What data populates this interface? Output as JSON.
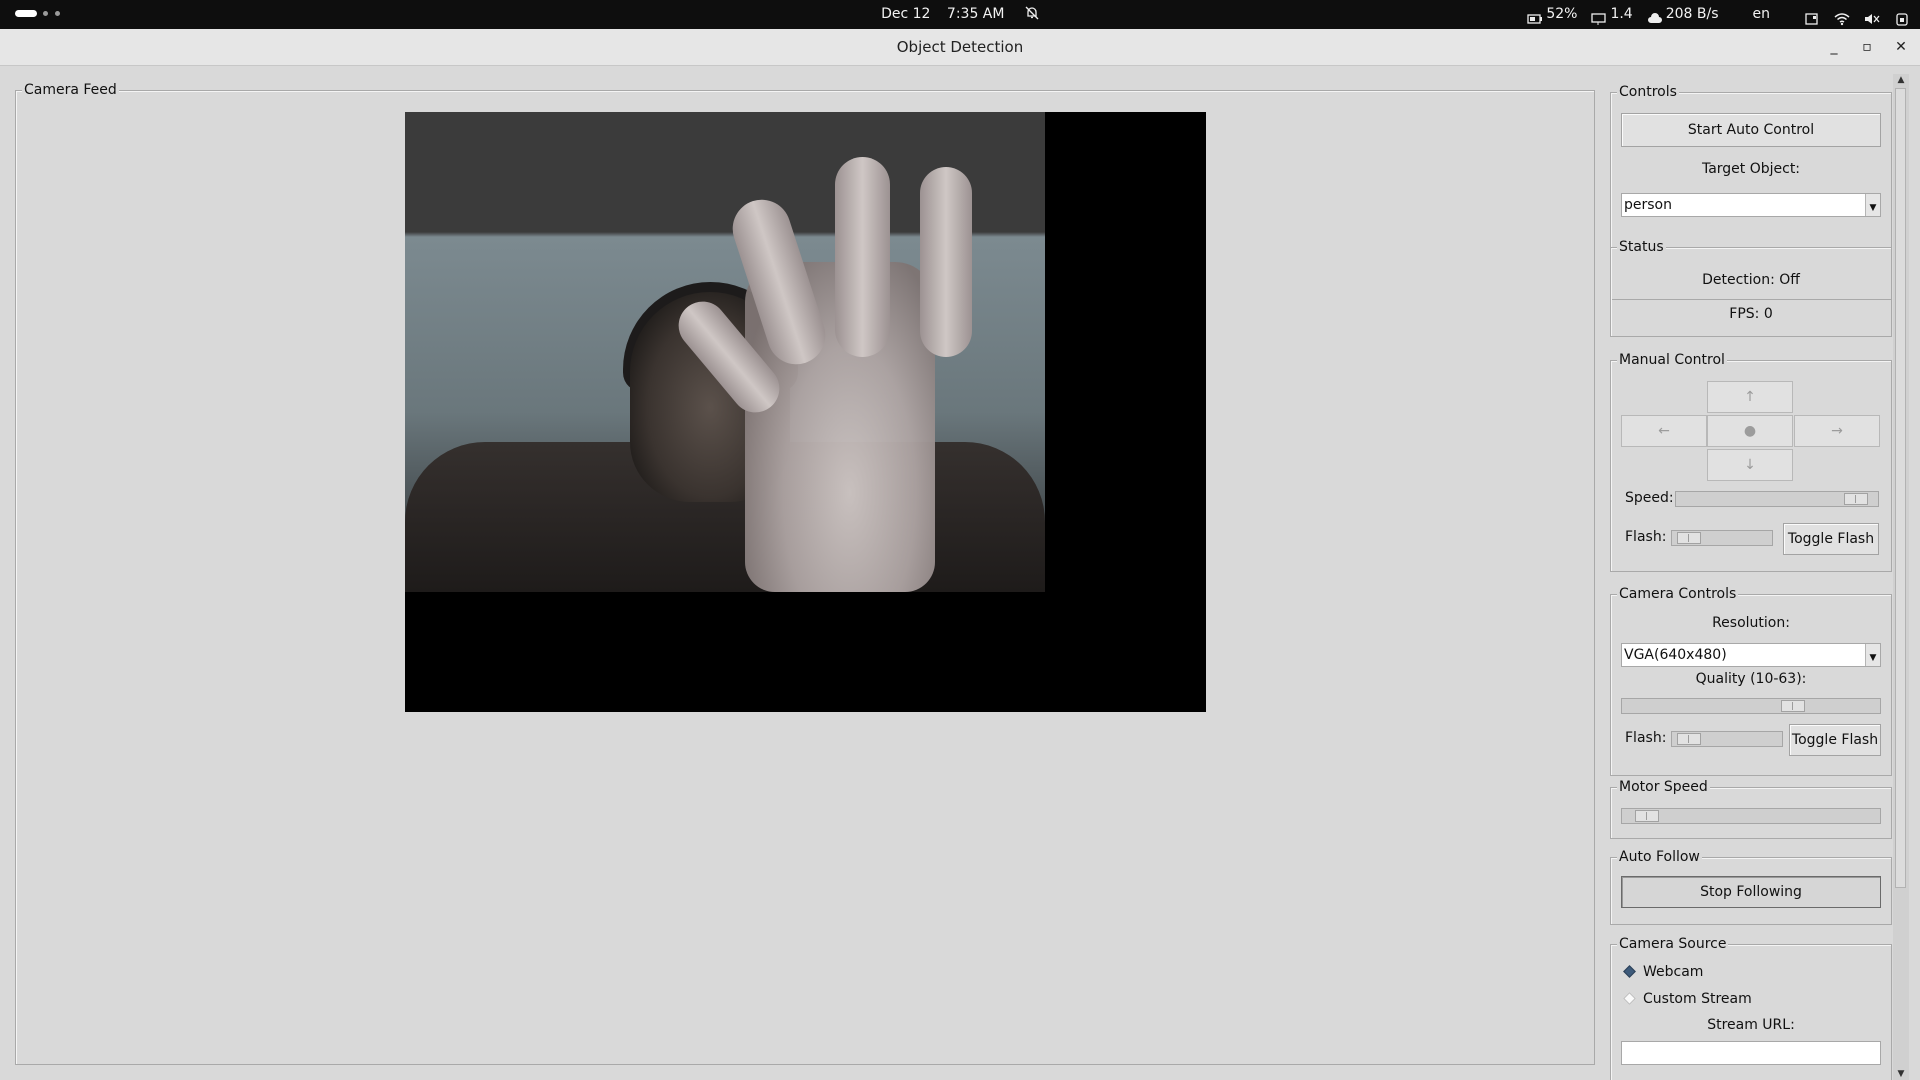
{
  "topbar": {
    "date": "Dec 12",
    "time": "7:35 AM",
    "battery": "52%",
    "display_level": "1.4",
    "network_rate": "208 B/s",
    "language": "en",
    "icons": [
      "bell-off-icon",
      "battery-icon",
      "display-icon",
      "cloud-icon",
      "screenshot-icon",
      "wifi-icon",
      "volume-muted-icon",
      "power-icon"
    ]
  },
  "window": {
    "title": "Object Detection",
    "minimize": "_",
    "maximize": "▫",
    "close": "✕"
  },
  "camera_feed": {
    "legend": "Camera Feed"
  },
  "controls": {
    "legend": "Controls",
    "start_auto": "Start Auto Control",
    "target_label": "Target Object:",
    "target_value": "person"
  },
  "status": {
    "legend": "Status",
    "detection": "Detection: Off",
    "fps": "FPS: 0"
  },
  "manual_control": {
    "legend": "Manual Control",
    "up": "↑",
    "left": "←",
    "center": "●",
    "right": "→",
    "down": "↓",
    "speed_label": "Speed:",
    "speed_value": 0.95,
    "flash_label": "Flash:",
    "flash_value": 0.05,
    "toggle_flash": "Toggle Flash"
  },
  "camera_controls": {
    "legend": "Camera Controls",
    "resolution_label": "Resolution:",
    "resolution_value": "VGA(640x480)",
    "quality_label": "Quality (10-63):",
    "quality_value": 0.68,
    "flash_label": "Flash:",
    "flash_value": 0.05,
    "toggle_flash": "Toggle Flash"
  },
  "motor_speed": {
    "legend": "Motor Speed",
    "value": 0.05
  },
  "auto_follow": {
    "legend": "Auto Follow",
    "button": "Stop Following"
  },
  "camera_source": {
    "legend": "Camera Source",
    "options": [
      {
        "label": "Webcam",
        "selected": true
      },
      {
        "label": "Custom Stream",
        "selected": false
      }
    ],
    "url_label": "Stream URL:",
    "url_value": ""
  },
  "colors": {
    "accent": "#3d5a7a",
    "bg": "#d9d9d9",
    "topbar": "#0e0e0e"
  }
}
